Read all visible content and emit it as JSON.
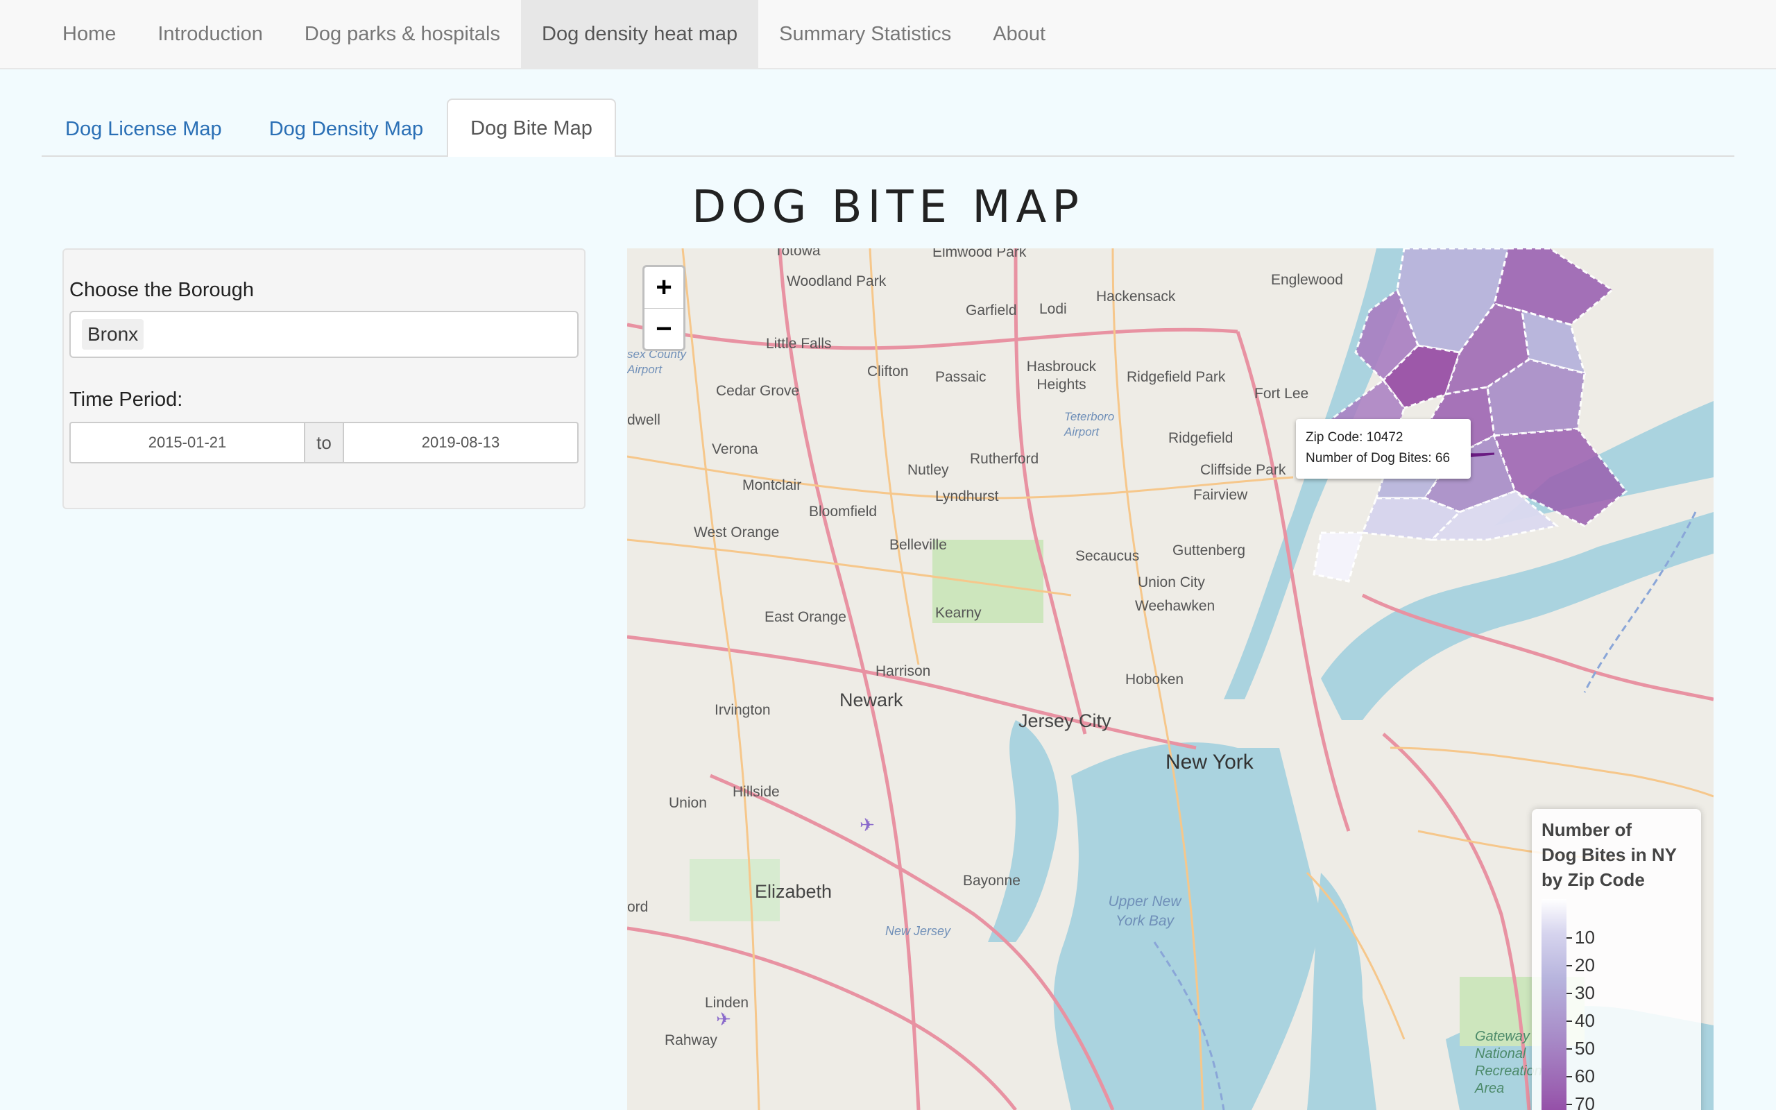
{
  "navbar": {
    "items": [
      "Home",
      "Introduction",
      "Dog parks & hospitals",
      "Dog density heat map",
      "Summary Statistics",
      "About"
    ],
    "active": "Dog density heat map"
  },
  "tabs": {
    "items": [
      "Dog License Map",
      "Dog Density Map",
      "Dog Bite Map"
    ],
    "active": "Dog Bite Map"
  },
  "title": "DOG BITE MAP",
  "controls": {
    "borough_label": "Choose the Borough",
    "borough_value": "Bronx",
    "period_label": "Time Period:",
    "date_start": "2015-01-21",
    "date_sep": "to",
    "date_end": "2019-08-13"
  },
  "map": {
    "zoom_in": "+",
    "zoom_out": "−",
    "tooltip": {
      "zip_line": "Zip Code: 10472",
      "bites_line": "Number of Dog Bites: 66"
    },
    "legend": {
      "title_line1": "Number of",
      "title_line2": "Dog Bites in NY",
      "title_line3": "by Zip Code",
      "ticks": [
        "10",
        "20",
        "30",
        "40",
        "50",
        "60",
        "70"
      ],
      "colors": {
        "low": "#ffffff",
        "high": "#8f3f9f"
      }
    },
    "place_labels": {
      "newark": "Newark",
      "new_york": "New York",
      "jersey_city": "Jersey City",
      "elizabeth": "Elizabeth",
      "hoboken": "Hoboken",
      "bayonne": "Bayonne",
      "woodland_park": "Woodland Park",
      "little_falls": "Little Falls",
      "clifton": "Clifton",
      "passaic": "Passaic",
      "garfield": "Garfield",
      "lodi": "Lodi",
      "hackensack": "Hackensack",
      "englewood": "Englewood",
      "elmwood_park": "Elmwood Park",
      "totowa": "Totowa",
      "hasbrouck_heights": "Hasbrouck Heights",
      "ridgefield_park": "Ridgefield Park",
      "fort_lee": "Fort Lee",
      "ridgefield": "Ridgefield",
      "cliffside_park": "Cliffside Park",
      "fairview": "Fairview",
      "cedar_grove": "Cedar Grove",
      "verona": "Verona",
      "montclair": "Montclair",
      "nutley": "Nutley",
      "rutherford": "Rutherford",
      "lyndhurst": "Lyndhurst",
      "bloomfield": "Bloomfield",
      "west_orange": "West Orange",
      "belleville": "Belleville",
      "secaucus": "Secaucus",
      "guttenberg": "Guttenberg",
      "union_city": "Union City",
      "weehawken": "Weehawken",
      "east_orange": "East Orange",
      "kearny": "Kearny",
      "harrison": "Harrison",
      "irvington": "Irvington",
      "hillside": "Hillside",
      "union": "Union",
      "linden": "Linden",
      "rahway": "Rahway",
      "teterboro": "Teterboro Airport",
      "essex_airport": "sex County Airport",
      "upper_bay": "Upper New York Bay",
      "new_jersey": "New Jersey",
      "gateway": "Gateway National Recreation Area",
      "caldwell": "dwell",
      "ford": "ord"
    }
  }
}
